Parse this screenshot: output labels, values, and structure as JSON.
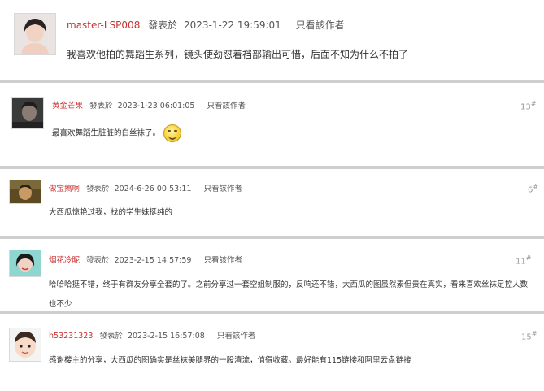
{
  "posts": [
    {
      "author": "master-LSP008",
      "posted_label": "發表於",
      "timestamp": "2023-1-22 19:59:01",
      "only_author": "只看該作者",
      "content": "我喜欢他拍的舞蹈生系列，镜头使劲怼着裆部输出可惜，后面不知为什么不拍了",
      "floor": ""
    },
    {
      "author": "黄金芒果",
      "posted_label": "發表於",
      "timestamp": "2023-1-23 06:01:05",
      "only_author": "只看該作者",
      "content": "最喜欢舞蹈生脏脏的白丝袜了。",
      "floor": "13",
      "floor_mark": "#"
    },
    {
      "author": "做宝搞啊",
      "posted_label": "發表於",
      "timestamp": "2024-6-26 00:53:11",
      "only_author": "只看該作者",
      "content": "大西瓜惊艳过我，找的学生妹挺纯的",
      "floor": "6",
      "floor_mark": "#"
    },
    {
      "author": "烟花冷昵",
      "posted_label": "發表於",
      "timestamp": "2023-2-15 14:57:59",
      "only_author": "只看該作者",
      "content": "哈哈哈挺不错，终于有群友分享全套的了。之前分享过一套空姐制服的，反响还不错，大西瓜的图虽然素但贵在真实，看来喜欢丝袜足控人数也不少",
      "floor": "11",
      "floor_mark": "#"
    },
    {
      "author": "h53231323",
      "posted_label": "發表於",
      "timestamp": "2023-2-15 16:57:08",
      "only_author": "只看該作者",
      "content": "感谢楼主的分享，大西瓜的图确实是丝袜美腿界的一股清流，值得收藏。最好能有115链接和阿里云盘链接",
      "floor": "15",
      "floor_mark": "#"
    }
  ]
}
